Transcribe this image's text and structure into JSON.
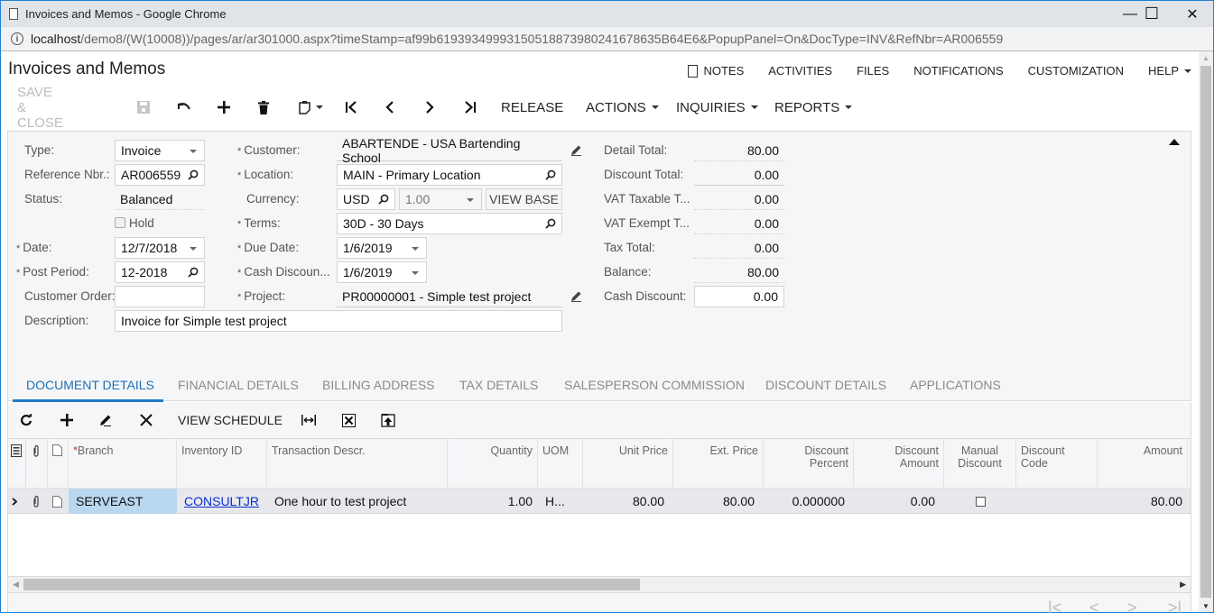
{
  "browser": {
    "window_title": "Invoices and Memos - Google Chrome",
    "url_host": "localhost",
    "url_rest": "/demo8/(W(10008))/pages/ar/ar301000.aspx?timeStamp=af99b61939349993150518873980241678635B64E6&PopupPanel=On&DocType=INV&RefNbr=AR006559",
    "controls": {
      "minimize": "—",
      "maximize": "☐",
      "close": "✕"
    }
  },
  "header": {
    "title": "Invoices and Memos",
    "topnav": [
      {
        "label": "NOTES",
        "icon": "note-icon"
      },
      {
        "label": "ACTIVITIES"
      },
      {
        "label": "FILES"
      },
      {
        "label": "NOTIFICATIONS"
      },
      {
        "label": "CUSTOMIZATION"
      },
      {
        "label": "HELP",
        "dropdown": true
      }
    ]
  },
  "toolbar": {
    "save_close": "SAVE & CLOSE",
    "release": "RELEASE",
    "actions": "ACTIONS",
    "inquiries": "INQUIRIES",
    "reports": "REPORTS"
  },
  "form": {
    "col1": {
      "type_label": "Type:",
      "type_value": "Invoice",
      "ref_label": "Reference Nbr.:",
      "ref_value": "AR006559",
      "status_label": "Status:",
      "status_value": "Balanced",
      "hold_label": "Hold",
      "hold_checked": false,
      "date_label": "Date:",
      "date_value": "12/7/2018",
      "period_label": "Post Period:",
      "period_value": "12-2018",
      "order_label": "Customer Order:",
      "order_value": "",
      "desc_label": "Description:",
      "desc_value": "Invoice for Simple test project"
    },
    "col2": {
      "customer_label": "Customer:",
      "customer_value": "ABARTENDE - USA Bartending School",
      "location_label": "Location:",
      "location_value": "MAIN - Primary Location",
      "currency_label": "Currency:",
      "currency_value": "USD",
      "rate_value": "1.00",
      "view_base": "VIEW BASE",
      "terms_label": "Terms:",
      "terms_value": "30D - 30 Days",
      "due_label": "Due Date:",
      "due_value": "1/6/2019",
      "cashdisc_label": "Cash Discoun...",
      "cashdisc_value": "1/6/2019",
      "project_label": "Project:",
      "project_value": "PR00000001 - Simple test project"
    },
    "col3": {
      "detail_total_label": "Detail Total:",
      "detail_total": "80.00",
      "discount_total_label": "Discount Total:",
      "discount_total": "0.00",
      "vat_taxable_label": "VAT Taxable T...",
      "vat_taxable": "0.00",
      "vat_exempt_label": "VAT Exempt T...",
      "vat_exempt": "0.00",
      "tax_total_label": "Tax Total:",
      "tax_total": "0.00",
      "balance_label": "Balance:",
      "balance": "80.00",
      "cash_discount_label": "Cash Discount:",
      "cash_discount": "0.00"
    },
    "required_marker": "*"
  },
  "tabs": [
    {
      "label": "DOCUMENT DETAILS",
      "active": true
    },
    {
      "label": "FINANCIAL DETAILS"
    },
    {
      "label": "BILLING ADDRESS"
    },
    {
      "label": "TAX DETAILS"
    },
    {
      "label": "SALESPERSON COMMISSION"
    },
    {
      "label": "DISCOUNT DETAILS"
    },
    {
      "label": "APPLICATIONS"
    }
  ],
  "grid_toolbar": {
    "view_schedule": "VIEW SCHEDULE"
  },
  "grid": {
    "columns": [
      {
        "key": "branch",
        "label": "Branch",
        "required": true
      },
      {
        "key": "inventory",
        "label": "Inventory ID"
      },
      {
        "key": "descr",
        "label": "Transaction Descr."
      },
      {
        "key": "qty",
        "label": "Quantity"
      },
      {
        "key": "uom",
        "label": "UOM"
      },
      {
        "key": "unit_price",
        "label": "Unit Price"
      },
      {
        "key": "ext_price",
        "label": "Ext. Price"
      },
      {
        "key": "disc_pct",
        "label": "Discount Percent"
      },
      {
        "key": "disc_amt",
        "label": "Discount Amount"
      },
      {
        "key": "manual",
        "label": "Manual Discount"
      },
      {
        "key": "disc_code",
        "label": "Discount Code"
      },
      {
        "key": "amount",
        "label": "Amount"
      }
    ],
    "rows": [
      {
        "branch": "SERVEAST",
        "inventory": "CONSULTJR",
        "descr": "One hour to test project",
        "qty": "1.00",
        "uom": "H...",
        "unit_price": "80.00",
        "ext_price": "80.00",
        "disc_pct": "0.000000",
        "disc_amt": "0.00",
        "manual": false,
        "disc_code": "",
        "amount": "80.00"
      }
    ]
  },
  "pager": {
    "first": "|<",
    "prev": "<",
    "next": ">",
    "last": ">|"
  }
}
